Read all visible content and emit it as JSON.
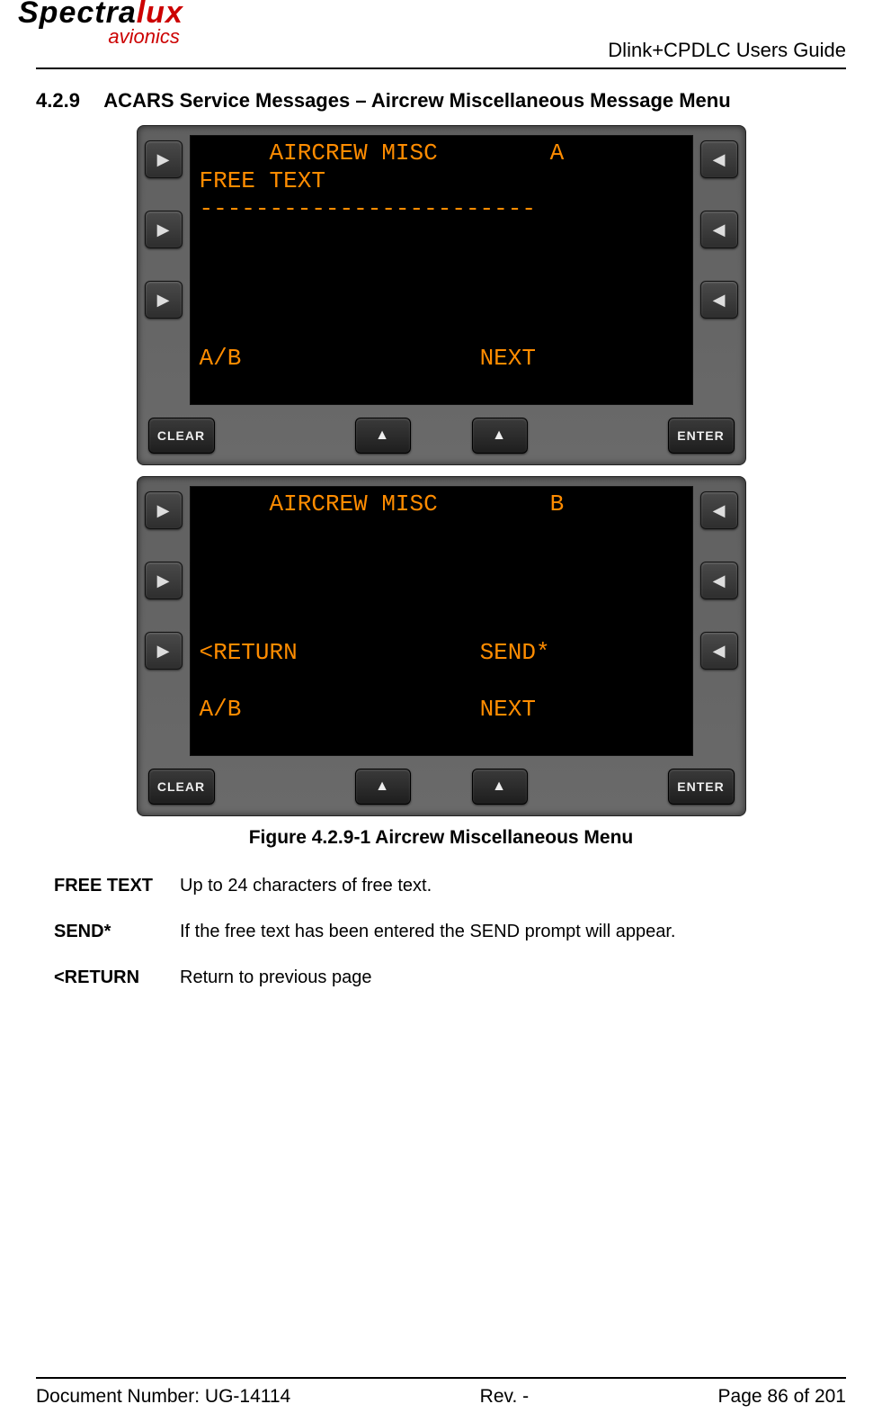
{
  "header": {
    "logo_part1": "Spectra",
    "logo_part2": "lux",
    "logo_sub": "avionics",
    "doc_title": "Dlink+CPDLC Users Guide"
  },
  "section": {
    "number": "4.2.9",
    "title": "ACARS Service Messages – Aircrew Miscellaneous Message Menu"
  },
  "screenA": {
    "l1": "     AIRCREW MISC        A",
    "l2": "FREE TEXT",
    "l3": "------------------------",
    "l6_left": "A/B",
    "l6_right": "NEXT"
  },
  "screenB": {
    "l1": "     AIRCREW MISC        B",
    "l5_left": "<RETURN",
    "l5_right": "SEND*",
    "l6_left": "A/B",
    "l6_right": "NEXT"
  },
  "buttons": {
    "clear": "CLEAR",
    "enter": "ENTER"
  },
  "caption": "Figure 4.2.9-1 Aircrew Miscellaneous Menu",
  "defs": [
    {
      "term": "FREE TEXT",
      "desc": "Up to 24 characters of free text."
    },
    {
      "term": "SEND*",
      "desc": "If the free text has been entered the SEND prompt will appear."
    },
    {
      "term": "<RETURN",
      "desc": "Return to previous page"
    }
  ],
  "footer": {
    "docnum": "Document Number:  UG-14114",
    "rev": "Rev. -",
    "page": "Page 86 of 201"
  }
}
